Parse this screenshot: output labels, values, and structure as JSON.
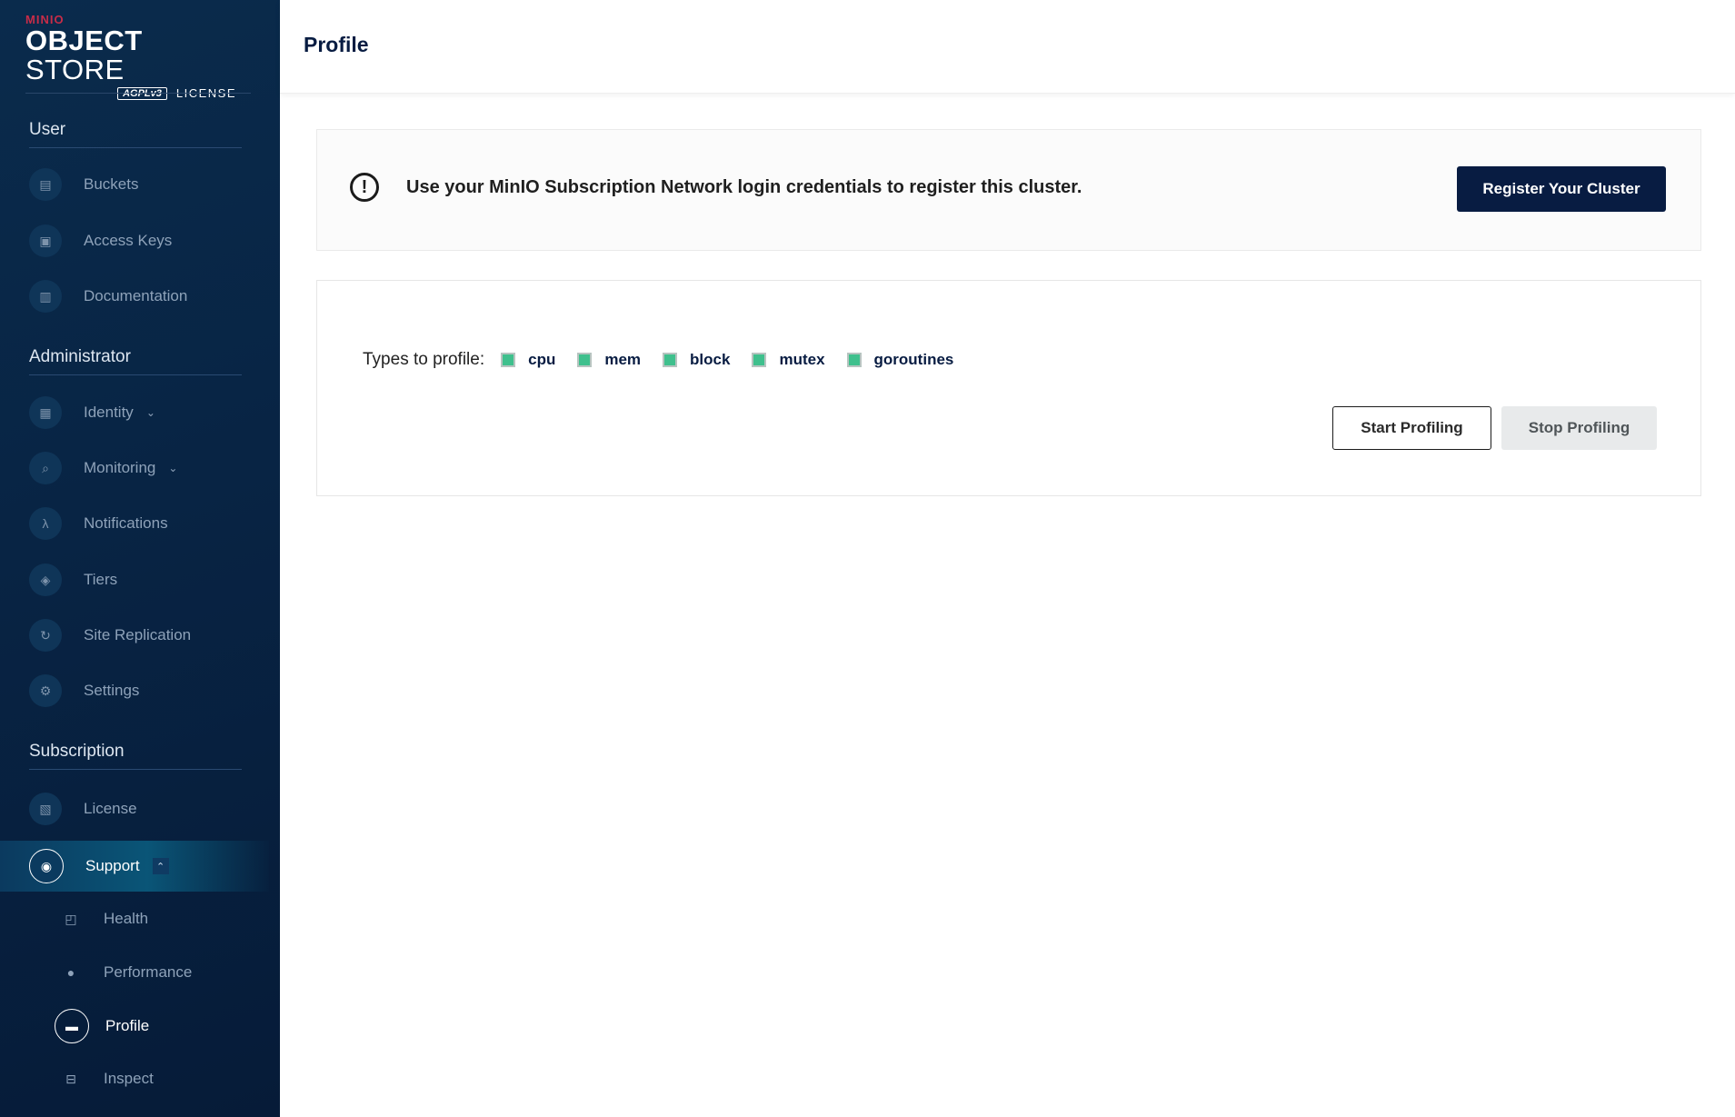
{
  "sidebar": {
    "logo": {
      "brand": "MINIO",
      "product_bold": "OBJECT",
      "product_rest": " STORE",
      "badge": "AGPLv3",
      "license": "LICENSE"
    },
    "sections": {
      "user": "User",
      "administrator": "Administrator",
      "subscription": "Subscription"
    },
    "items": {
      "buckets": "Buckets",
      "access_keys": "Access Keys",
      "documentation": "Documentation",
      "identity": "Identity",
      "monitoring": "Monitoring",
      "notifications": "Notifications",
      "tiers": "Tiers",
      "site_replication": "Site Replication",
      "settings": "Settings",
      "license": "License",
      "support": "Support",
      "health": "Health",
      "performance": "Performance",
      "profile": "Profile",
      "inspect": "Inspect"
    }
  },
  "header": {
    "title": "Profile"
  },
  "banner": {
    "message": "Use your MinIO Subscription Network login credentials to register this cluster.",
    "button": "Register Your Cluster"
  },
  "profile": {
    "types_label": "Types to profile:",
    "types": [
      {
        "label": "cpu",
        "checked": true
      },
      {
        "label": "mem",
        "checked": true
      },
      {
        "label": "block",
        "checked": true
      },
      {
        "label": "mutex",
        "checked": true
      },
      {
        "label": "goroutines",
        "checked": true
      }
    ],
    "start_button": "Start Profiling",
    "stop_button": "Stop Profiling"
  },
  "colors": {
    "accent": "#081c42",
    "checkbox": "#3fc08d",
    "sidebar": "#082444"
  }
}
